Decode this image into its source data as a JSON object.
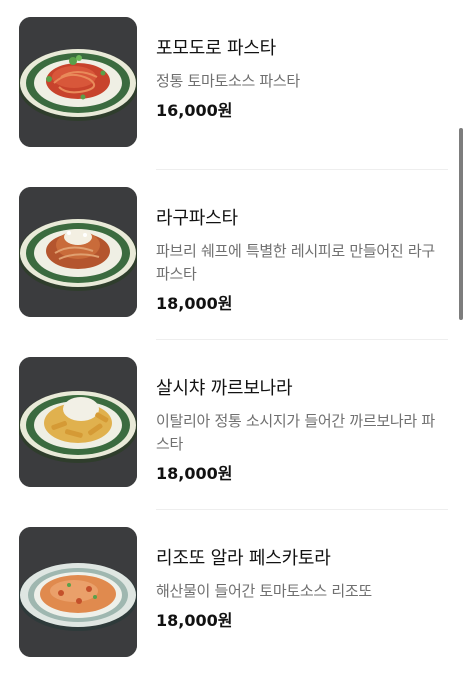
{
  "menu": {
    "items": [
      {
        "name": "포모도로 파스타",
        "description": "정통 토마토소스 파스타",
        "price": "16,000원",
        "photo": "pomodoro-pasta-photo"
      },
      {
        "name": "라구파스타",
        "description": "파브리 쉐프에 특별한 레시피로 만들어진 라구 파스타",
        "price": "18,000원",
        "photo": "ragu-pasta-photo"
      },
      {
        "name": "살시챠 까르보나라",
        "description": "이탈리아 정통 소시지가 들어간 까르보나라 파스타",
        "price": "18,000원",
        "photo": "salsiccia-carbonara-photo"
      },
      {
        "name": "리조또 알라 페스카토라",
        "description": "해산물이 들어간 토마토소스 리조또",
        "price": "18,000원",
        "photo": "risotto-pescatora-photo"
      }
    ]
  },
  "colors": {
    "background": "#ffffff",
    "text_primary": "#121212",
    "text_secondary": "#707070",
    "divider": "#eeeeee",
    "scrollbar": "#7d7d7d"
  }
}
